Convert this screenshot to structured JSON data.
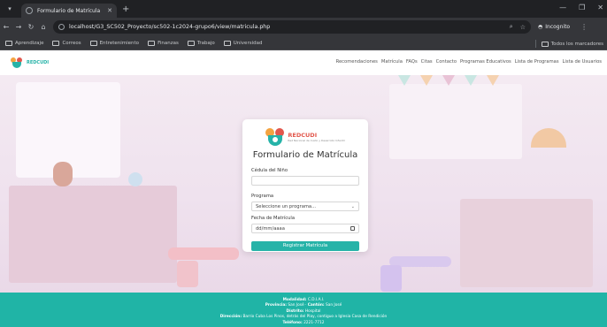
{
  "browser": {
    "tab_title": "Formulario de Matrícula",
    "url": "localhost/G3_SC502_Proyecto/sc502-1c2024-grupo6/view/matricula.php",
    "profile_label": "Incognito",
    "bookmarks": [
      "Aprendizaje",
      "Correos",
      "Entretenimiento",
      "Finanzas",
      "Trabajo",
      "Universidad"
    ],
    "all_bookmarks_label": "Todos los marcadores"
  },
  "site": {
    "brand": "REDCUDI",
    "menu": [
      "Recomendaciones",
      "Matrícula",
      "FAQs",
      "Citas",
      "Contacto",
      "Programas Educativos",
      "Lista de Programas",
      "Lista de Usuarios"
    ]
  },
  "form": {
    "logo_brand": "REDCUDI",
    "logo_tagline": "Red Nacional de Cuido y Desarrollo Infantil",
    "title": "Formulario de Matrícula",
    "cedula_label": "Cédula del Niño",
    "cedula_value": "",
    "programa_label": "Programa",
    "programa_value": "Seleccione un programa...",
    "fecha_label": "Fecha de Matrícula",
    "fecha_value": "dd/mm/aaaa",
    "submit_label": "Registrar Matrícula"
  },
  "footer": {
    "lines": [
      {
        "label": "Modalidad:",
        "value": "C.D.I.A.I."
      },
      {
        "label": "Provincia:",
        "value": "San José",
        "label2": "Cantón:",
        "value2": "San José"
      },
      {
        "label": "Distrito:",
        "value": "Hospital"
      },
      {
        "label": "Dirección:",
        "value": "Barrio Cuba Los Pinos, detrás del Play, contiguo a Iglesia Casa de Rendición"
      },
      {
        "label": "Teléfono:",
        "value": "2221-7712"
      }
    ]
  },
  "colors": {
    "accent": "#26b3a8",
    "footer": "#20b4a6",
    "brand_red": "#e2574c",
    "brand_orange": "#f4a340"
  }
}
